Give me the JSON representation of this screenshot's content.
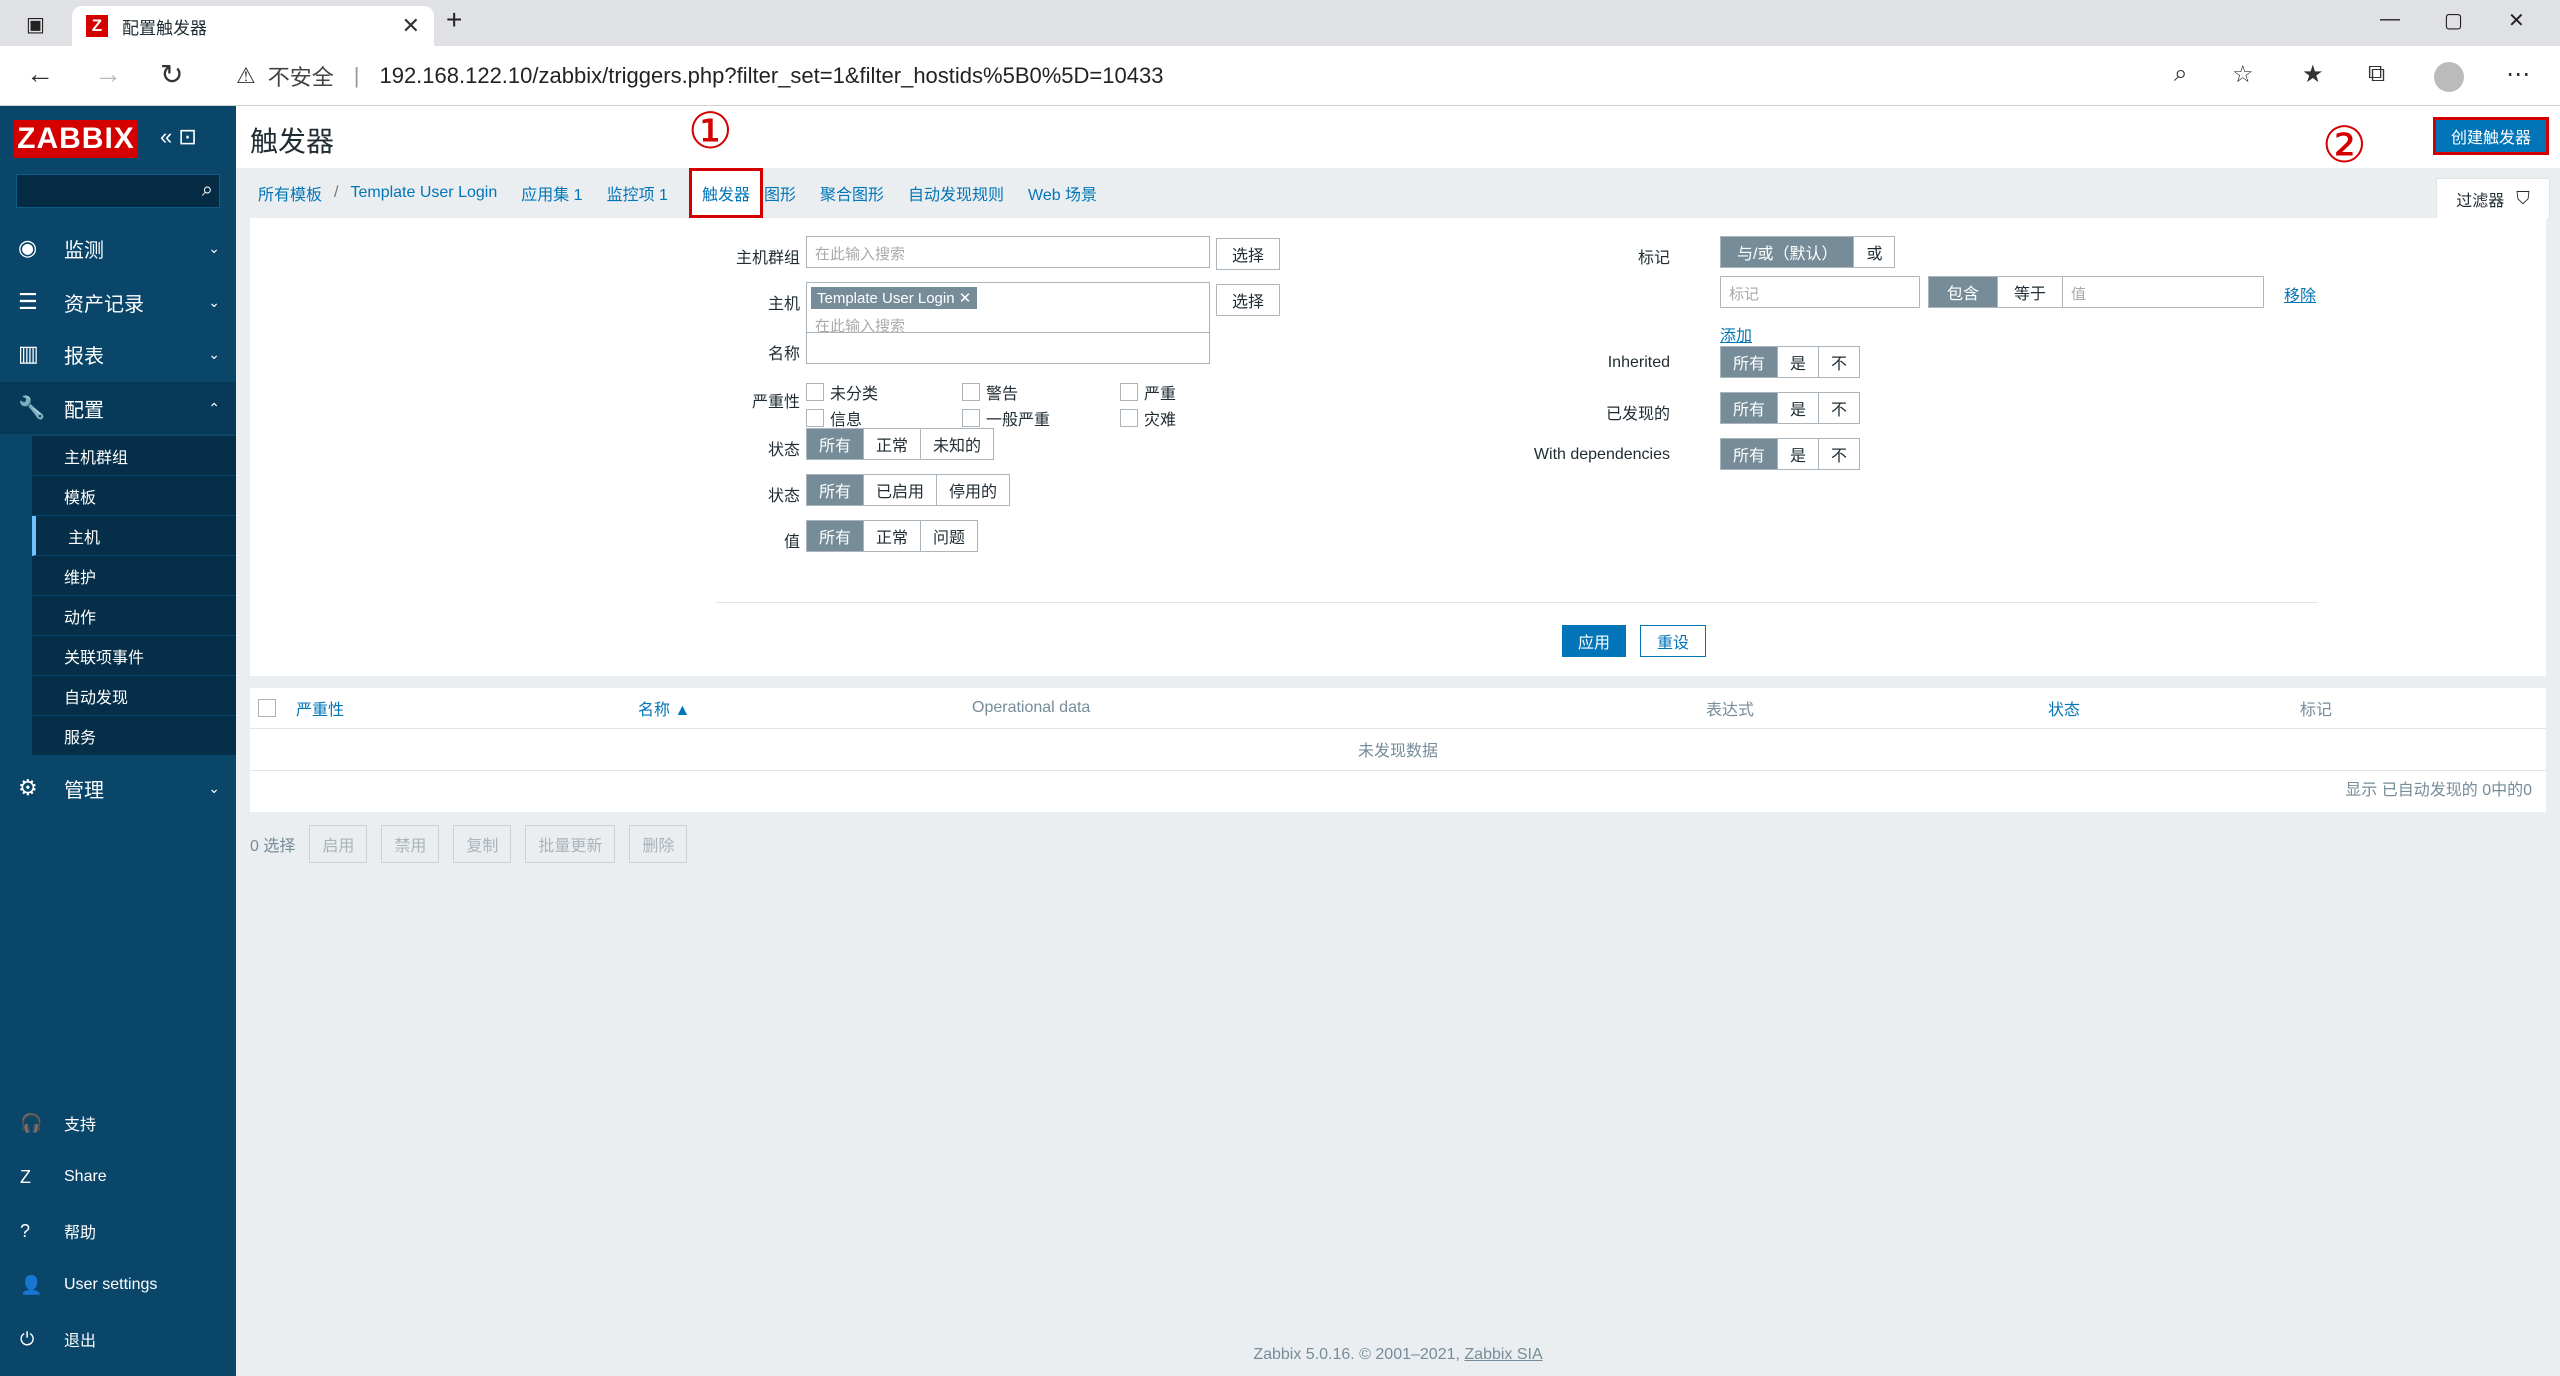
{
  "browser": {
    "tab_title": "配置触发器",
    "tab_favicon": "Z",
    "security": "不安全",
    "url": "192.168.122.10/zabbix/triggers.php?filter_set=1&filter_hostids%5B0%5D=10433"
  },
  "sidebar": {
    "logo": "ZABBIX",
    "menu": [
      {
        "label": "监测",
        "icon": "eye-icon"
      },
      {
        "label": "资产记录",
        "icon": "list-icon"
      },
      {
        "label": "报表",
        "icon": "chart-icon"
      },
      {
        "label": "配置",
        "icon": "wrench-icon"
      },
      {
        "label": "管理",
        "icon": "gear-icon"
      }
    ],
    "submenu": [
      "主机群组",
      "模板",
      "主机",
      "维护",
      "动作",
      "关联项事件",
      "自动发现",
      "服务"
    ],
    "footer": [
      {
        "label": "支持",
        "icon": "headset-icon"
      },
      {
        "label": "Share",
        "icon": "share-icon"
      },
      {
        "label": "帮助",
        "icon": "help-icon"
      },
      {
        "label": "User settings",
        "icon": "user-icon"
      },
      {
        "label": "退出",
        "icon": "power-icon"
      }
    ]
  },
  "header": {
    "title": "触发器",
    "create_button": "创建触发器",
    "marker1": "①",
    "marker2": "②"
  },
  "breadcrumbs": {
    "all_templates": "所有模板",
    "template": "Template User Login",
    "apps": "应用集 1",
    "items": "监控项 1",
    "triggers": "触发器",
    "graphs": "图形",
    "screens": "聚合图形",
    "discovery": "自动发现规则",
    "web": "Web 场景"
  },
  "filter": {
    "tab_label": "过滤器",
    "hostgroup_label": "主机群组",
    "hostgroup_placeholder": "在此输入搜索",
    "host_label": "主机",
    "host_tag": "Template User Login",
    "host_placeholder": "在此输入搜索",
    "select_label": "选择",
    "name_label": "名称",
    "severity_label": "严重性",
    "severities": [
      "未分类",
      "警告",
      "严重",
      "信息",
      "一般严重",
      "灾难"
    ],
    "state_label": "状态",
    "state_options": [
      "所有",
      "正常",
      "未知的"
    ],
    "status_label": "状态",
    "status_options": [
      "所有",
      "已启用",
      "停用的"
    ],
    "value_label": "值",
    "value_options": [
      "所有",
      "正常",
      "问题"
    ],
    "tags_label": "标记",
    "tags_options": [
      "与/或（默认）",
      "或"
    ],
    "tag_placeholder": "标记",
    "tag_ops": [
      "包含",
      "等于"
    ],
    "tag_value_placeholder": "值",
    "remove": "移除",
    "add": "添加",
    "inherited_label": "Inherited",
    "discovered_label": "已发现的",
    "deps_label": "With dependencies",
    "yn_options": [
      "所有",
      "是",
      "不"
    ],
    "apply": "应用",
    "reset": "重设"
  },
  "table": {
    "columns": [
      "严重性",
      "名称 ▲",
      "Operational data",
      "表达式",
      "状态",
      "标记"
    ],
    "no_data": "未发现数据",
    "count": "显示 已自动发现的 0中的0"
  },
  "actions": {
    "selected": "0 选择",
    "buttons": [
      "启用",
      "禁用",
      "复制",
      "批量更新",
      "删除"
    ]
  },
  "footer": {
    "text": "Zabbix 5.0.16. © 2001–2021, ",
    "link": "Zabbix SIA"
  }
}
